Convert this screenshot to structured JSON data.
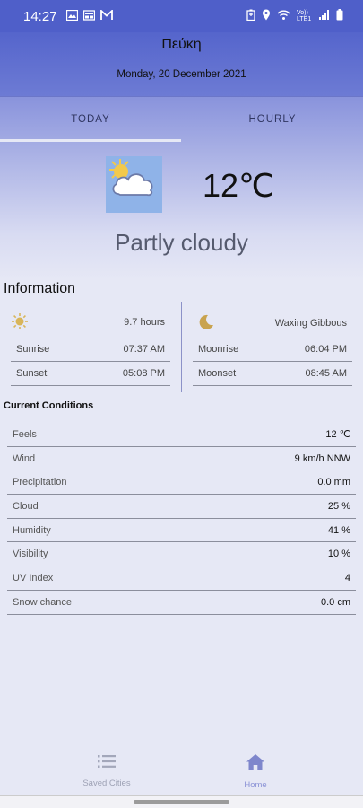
{
  "status_bar": {
    "time": "14:27",
    "icons_left": [
      "image-icon",
      "card-icon",
      "gmail-icon"
    ],
    "icons_right": [
      "battery-saver-icon",
      "location-icon",
      "wifi-icon",
      "volte-icon",
      "signal-icon",
      "battery-icon"
    ],
    "volte_text": "Vo)) LTE1"
  },
  "header": {
    "city": "Πεύκη",
    "date": "Monday, 20 December 2021"
  },
  "tabs": [
    {
      "label": "TODAY",
      "selected": true
    },
    {
      "label": "HOURLY",
      "selected": false
    }
  ],
  "current": {
    "icon": "partly-cloudy-icon",
    "temperature": "12℃",
    "condition": "Partly cloudy"
  },
  "information": {
    "title": "Information",
    "sun": {
      "icon": "sun-icon",
      "daylight": "9.7 hours",
      "sunrise_label": "Sunrise",
      "sunrise": "07:37 AM",
      "sunset_label": "Sunset",
      "sunset": "05:08 PM"
    },
    "moon": {
      "icon": "moon-icon",
      "phase": "Waxing Gibbous",
      "moonrise_label": "Moonrise",
      "moonrise": "06:04 PM",
      "moonset_label": "Moonset",
      "moonset": "08:45 AM"
    }
  },
  "current_conditions": {
    "title": "Current Conditions",
    "rows": [
      {
        "label": "Feels",
        "value": "12 ℃"
      },
      {
        "label": "Wind",
        "value": "9 km/h NNW"
      },
      {
        "label": "Precipitation",
        "value": "0.0 mm"
      },
      {
        "label": "Cloud",
        "value": "25 %"
      },
      {
        "label": "Humidity",
        "value": "41 %"
      },
      {
        "label": "Visibility",
        "value": "10 %"
      },
      {
        "label": "UV Index",
        "value": "4"
      },
      {
        "label": "Snow chance",
        "value": "0.0 cm"
      }
    ]
  },
  "bottom_nav": [
    {
      "label": "Saved Cities",
      "icon": "list-icon",
      "selected": false
    },
    {
      "label": "Home",
      "icon": "home-icon",
      "selected": true
    }
  ],
  "colors": {
    "status_bar": "#4f5fc9",
    "background": "#e6e8f5",
    "accent": "#8a92d6",
    "sun": "#d8b55a",
    "moon": "#c9a34e"
  }
}
